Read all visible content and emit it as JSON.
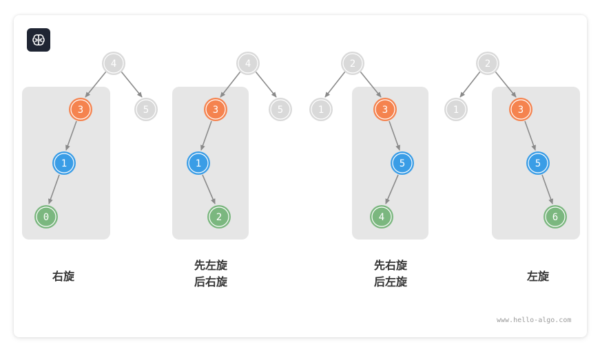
{
  "colors": {
    "gray_node": "#d9d9d9",
    "orange_node": "#f5834f",
    "blue_node": "#3a9de6",
    "green_node": "#7bb77f",
    "highlight_box": "#e6e6e6",
    "edge": "#8a8a8a"
  },
  "logo": {
    "icon": "brain-icon"
  },
  "panels": [
    {
      "caption_lines": [
        "右旋"
      ],
      "nodes": [
        "4",
        "3",
        "5",
        "1",
        "0"
      ]
    },
    {
      "caption_lines": [
        "先左旋",
        "后右旋"
      ],
      "nodes": [
        "4",
        "3",
        "5",
        "1",
        "2"
      ]
    },
    {
      "caption_lines": [
        "先右旋",
        "后左旋"
      ],
      "nodes": [
        "2",
        "1",
        "3",
        "5",
        "4"
      ]
    },
    {
      "caption_lines": [
        "左旋"
      ],
      "nodes": [
        "2",
        "1",
        "3",
        "5",
        "6"
      ]
    }
  ],
  "watermark": "www.hello-algo.com"
}
